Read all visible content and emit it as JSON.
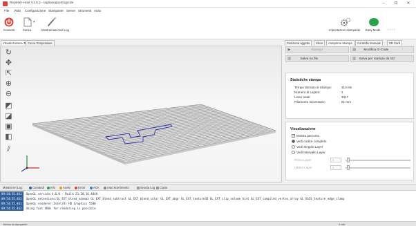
{
  "window": {
    "title": "Repetier-Host V1.6.2 - tagliosupporti1grcde",
    "controls": [
      "–",
      "⊡",
      "✕"
    ]
  },
  "menu": [
    "File",
    "Vista",
    "Configurazione",
    "Stampante",
    "Server",
    "Strumenti",
    "Aiuto"
  ],
  "toolbar": {
    "connect": "Connetti",
    "load": "Carica",
    "show_log": "Mostra/nascondi Log",
    "printer_settings": "Impostazioni stampante",
    "easy_mode": "Easy Mode",
    "temp": "1 2 0 0"
  },
  "left_tabs": [
    "Visualizzazione 3D",
    "Curva Temperature"
  ],
  "right_tabs": [
    "Posiziona oggetto",
    "Slicer",
    "Anteprima Stampa",
    "Controllo manuale",
    "SD Card"
  ],
  "preview": {
    "print_btn": "Stampa",
    "modify_btn": "Modifica G-Code",
    "save_file_btn": "Salva su file",
    "save_sd_btn": "Salva per stampa da SD",
    "stats_title": "Statistiche stampa",
    "stats": [
      {
        "label": "Tempo Stimato di Stampa:",
        "value": "31m 8s"
      },
      {
        "label": "Numero di Layers:",
        "value": "1"
      },
      {
        "label": "Linee totali:",
        "value": "1017"
      },
      {
        "label": "Filamento necessario:",
        "value": "81 mm"
      }
    ],
    "viz_title": "Visualizzazione",
    "show_path": "Mostra percorso",
    "show_all": "Vedi codice completo",
    "single_layer": "Vedi Singolo Layer",
    "layer_range": "Vedi Intervallo Layer",
    "first_layer": "Primo Layer",
    "last_layer": "Ultimo Layer",
    "first_val": "0",
    "last_val": "0"
  },
  "log": {
    "tabs": [
      "Mostra nel Log:",
      "Comandi",
      "Info",
      "Avvisi",
      "Errori",
      "ACK",
      "Auto scorrimento",
      "Svuota Log",
      "Copia"
    ],
    "lines": [
      {
        "ts": "09:54:55.461",
        "text": "OpenGL version:4.6.0 - Build 23.20.16.4849"
      },
      {
        "ts": "09:54:55.461",
        "text": "OpenGL extensions:GL_EXT_blend_minmax GL_EXT_blend_subtract GL_EXT_blend_color GL_EXT_abgr GL_EXT_texture3D GL_EXT_clip_volume_hint GL_EXT_compiled_vertex_array GL_SGIS_texture_edge_clamp"
      },
      {
        "ts": "09:54:55.461",
        "text": "OpenGL renderer:Intel(R) HD Graphics 5500"
      },
      {
        "ts": "09:54:55.462",
        "text": "Using fast VBOs for rendering is possible"
      }
    ]
  },
  "status": {
    "left": "Nessuna stampante",
    "right": "0 idle"
  },
  "colors": {
    "accent": "#2f5f9a",
    "connect": "#d64541",
    "easy": "#2aa24a",
    "path": "#2b2fa8"
  }
}
